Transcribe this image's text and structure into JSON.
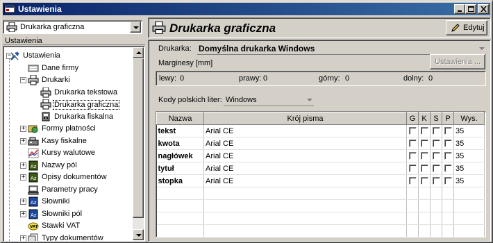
{
  "window": {
    "title": "Ustawienia"
  },
  "left": {
    "combo_value": "Drukarka graficzna",
    "section_label": "Ustawienia",
    "tree": [
      {
        "label": "Ustawienia",
        "icon": "wrench-icon",
        "expander": "minus",
        "level": 0
      },
      {
        "label": "Dane firmy",
        "icon": "company-icon",
        "expander": "",
        "level": 1
      },
      {
        "label": "Drukarki",
        "icon": "printer-icon",
        "expander": "minus",
        "level": 1
      },
      {
        "label": "Drukarka tekstowa",
        "icon": "printer-icon",
        "expander": "",
        "level": 2
      },
      {
        "label": "Drukarka graficzna",
        "icon": "printer-icon",
        "expander": "",
        "level": 2,
        "selected": true
      },
      {
        "label": "Drukarka fiskalna",
        "icon": "fiscal-printer-icon",
        "expander": "",
        "level": 2
      },
      {
        "label": "Formy płatności",
        "icon": "payment-icon",
        "expander": "plus",
        "level": 1
      },
      {
        "label": "Kasy fiskalne",
        "icon": "cash-register-icon",
        "expander": "plus",
        "level": 1
      },
      {
        "label": "Kursy walutowe",
        "icon": "chart-icon",
        "expander": "",
        "level": 1
      },
      {
        "label": "Nazwy pól",
        "icon": "az-icon",
        "expander": "plus",
        "level": 1
      },
      {
        "label": "Opisy dokumentów",
        "icon": "az-icon",
        "expander": "plus",
        "level": 1
      },
      {
        "label": "Parametry pracy",
        "icon": "computer-icon",
        "expander": "",
        "level": 1
      },
      {
        "label": "Słowniki",
        "icon": "az-blue-icon",
        "expander": "plus",
        "level": 1
      },
      {
        "label": "Słowniki pól",
        "icon": "az-blue-icon",
        "expander": "plus",
        "level": 1
      },
      {
        "label": "Stawki VAT",
        "icon": "vat-icon",
        "expander": "",
        "level": 1
      },
      {
        "label": "Typy dokumentów",
        "icon": "documents-icon",
        "expander": "plus",
        "level": 1
      }
    ]
  },
  "right": {
    "header_title": "Drukarka graficzna",
    "edit_label": "Edytuj",
    "printer_label": "Drukarka:",
    "printer_value": "Domyślna drukarka Windows",
    "margins_label": "Marginesy [mm]",
    "settings_button": "Ustawienia ...",
    "margins": [
      {
        "label": "lewy:",
        "value": "0"
      },
      {
        "label": "prawy:",
        "value": "0"
      },
      {
        "label": "górny:",
        "value": "0"
      },
      {
        "label": "dolny:",
        "value": "0"
      }
    ],
    "codes_label": "Kody polskich liter:",
    "codes_value": "Windows",
    "grid": {
      "headers": [
        "Nazwa",
        "Krój pisma",
        "G",
        "K",
        "S",
        "P",
        "Wys."
      ],
      "rows": [
        {
          "name": "tekst",
          "font": "Arial CE",
          "size": "35"
        },
        {
          "name": "kwota",
          "font": "Arial CE",
          "size": "35"
        },
        {
          "name": "nagłówek",
          "font": "Arial CE",
          "size": "35"
        },
        {
          "name": "tytuł",
          "font": "Arial CE",
          "size": "35"
        },
        {
          "name": "stopka",
          "font": "Arial CE",
          "size": "35"
        }
      ]
    }
  }
}
